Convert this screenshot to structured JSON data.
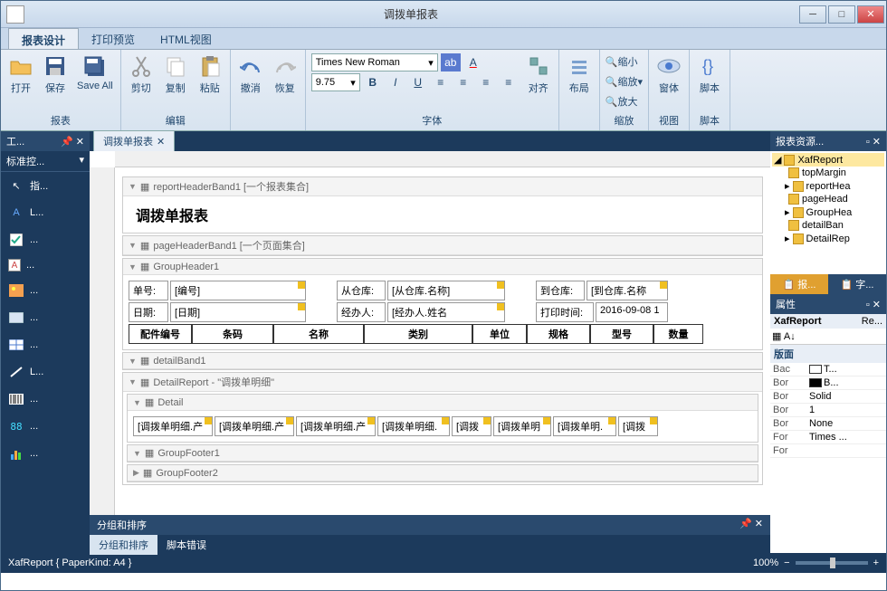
{
  "window": {
    "title": "调拨单报表"
  },
  "tabs": {
    "design": "报表设计",
    "preview": "打印预览",
    "html": "HTML视图"
  },
  "ribbon": {
    "open": "打开",
    "save": "保存",
    "saveall": "Save All",
    "cut": "剪切",
    "copy": "复制",
    "paste": "粘贴",
    "undo": "撤消",
    "redo": "恢复",
    "font": "Times New Roman",
    "size": "9.75",
    "align": "对齐",
    "layout": "布局",
    "zoomout": "缩小",
    "zoomfit": "缩放",
    "zoomin": "放大",
    "window": "窗体",
    "script": "脚本",
    "g_report": "报表",
    "g_edit": "编辑",
    "g_font": "字体",
    "g_zoom": "缩放",
    "g_view": "视图",
    "g_script": "脚本"
  },
  "toolbox": {
    "title": "工...",
    "section": "标准控...",
    "items": [
      "指...",
      "L...",
      "...",
      "...",
      "...",
      "...",
      "...",
      "L...",
      "...",
      "...",
      "..."
    ]
  },
  "doc": {
    "tab": "调拨单报表"
  },
  "bands": {
    "reportHeader": "reportHeaderBand1  [一个报表集合]",
    "pageHeader": "pageHeaderBand1  [一个页面集合]",
    "groupHeader": "GroupHeader1",
    "detailBand": "detailBand1",
    "detailReport": "DetailReport - \"调拨单明细\"",
    "detail": "Detail",
    "groupFooter1": "GroupFooter1",
    "groupFooter2": "GroupFooter2"
  },
  "report": {
    "title": "调拨单报表",
    "labels": {
      "billno": "单号:",
      "fromwh": "从仓库:",
      "towh": "到仓库:",
      "date": "日期:",
      "handler": "经办人:",
      "printtime": "打印时间:"
    },
    "fields": {
      "billno": "[编号]",
      "fromwh": "[从仓库.名称]",
      "towh": "[到仓库.名称",
      "date": "[日期]",
      "handler": "[经办人.姓名",
      "printtime": "2016-09-08 1"
    },
    "columns": [
      "配件编号",
      "条码",
      "名称",
      "类别",
      "单位",
      "规格",
      "型号",
      "数量"
    ],
    "detail_cells": [
      "[调拨单明细.产",
      "[调拨单明细.产",
      "[调拨单明细.产",
      "[调拨单明细.",
      "[调拨",
      "[调拨单明",
      "[调拨单明.",
      "[调拨"
    ]
  },
  "bottom": {
    "title": "分组和排序",
    "tab1": "分组和排序",
    "tab2": "脚本错误"
  },
  "explorer": {
    "title": "报表资源...",
    "root": "XafReport",
    "nodes": [
      "topMargin",
      "reportHea",
      "pageHead",
      "GroupHea",
      "detailBan",
      "DetailRep"
    ],
    "tab1": "报...",
    "tab2": "字..."
  },
  "props": {
    "title": "属性",
    "obj": "XafReport",
    "objtype": "Re...",
    "cat": "版面",
    "rows": [
      {
        "k": "Bac",
        "v": "T...",
        "color": "#ffffff"
      },
      {
        "k": "Bor",
        "v": "B...",
        "color": "#000000"
      },
      {
        "k": "Bor",
        "v": "Solid"
      },
      {
        "k": "Bor",
        "v": "1"
      },
      {
        "k": "Bor",
        "v": "None"
      },
      {
        "k": "For",
        "v": "Times ..."
      },
      {
        "k": "For",
        "v": ""
      }
    ]
  },
  "status": {
    "text": "XafReport { PaperKind: A4 }",
    "zoom": "100%"
  }
}
